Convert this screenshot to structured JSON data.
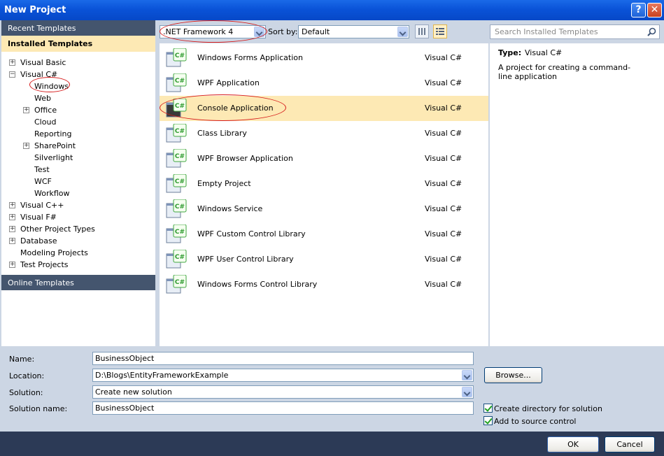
{
  "window": {
    "title": "New Project",
    "help_glyph": "?",
    "close_glyph": "✕"
  },
  "left_panel": {
    "recent_templates": "Recent Templates",
    "installed_templates": "Installed Templates",
    "online_templates": "Online Templates",
    "tree": [
      {
        "label": "Visual Basic",
        "toggle": "+"
      },
      {
        "label": "Visual C#",
        "toggle": "−"
      },
      {
        "label": "Windows",
        "toggle": ""
      },
      {
        "label": "Web",
        "toggle": ""
      },
      {
        "label": "Office",
        "toggle": "+"
      },
      {
        "label": "Cloud",
        "toggle": ""
      },
      {
        "label": "Reporting",
        "toggle": ""
      },
      {
        "label": "SharePoint",
        "toggle": "+"
      },
      {
        "label": "Silverlight",
        "toggle": ""
      },
      {
        "label": "Test",
        "toggle": ""
      },
      {
        "label": "WCF",
        "toggle": ""
      },
      {
        "label": "Workflow",
        "toggle": ""
      },
      {
        "label": "Visual C++",
        "toggle": "+"
      },
      {
        "label": "Visual F#",
        "toggle": "+"
      },
      {
        "label": "Other Project Types",
        "toggle": "+"
      },
      {
        "label": "Database",
        "toggle": "+"
      },
      {
        "label": "Modeling Projects",
        "toggle": ""
      },
      {
        "label": "Test Projects",
        "toggle": "+"
      }
    ]
  },
  "toolbar": {
    "framework": ".NET Framework 4",
    "sort_label": "Sort by:",
    "sort_value": "Default",
    "search_placeholder": "Search Installed Templates"
  },
  "templates": [
    {
      "name": "Windows Forms Application",
      "language": "Visual C#",
      "icon": "windows-forms-app-icon"
    },
    {
      "name": "WPF Application",
      "language": "Visual C#",
      "icon": "wpf-app-icon"
    },
    {
      "name": "Console Application",
      "language": "Visual C#",
      "icon": "console-app-icon"
    },
    {
      "name": "Class Library",
      "language": "Visual C#",
      "icon": "class-library-icon"
    },
    {
      "name": "WPF Browser Application",
      "language": "Visual C#",
      "icon": "wpf-browser-app-icon"
    },
    {
      "name": "Empty Project",
      "language": "Visual C#",
      "icon": "empty-project-icon"
    },
    {
      "name": "Windows Service",
      "language": "Visual C#",
      "icon": "windows-service-icon"
    },
    {
      "name": "WPF Custom Control Library",
      "language": "Visual C#",
      "icon": "wpf-custom-control-icon"
    },
    {
      "name": "WPF User Control Library",
      "language": "Visual C#",
      "icon": "wpf-user-control-icon"
    },
    {
      "name": "Windows Forms Control Library",
      "language": "Visual C#",
      "icon": "winforms-control-library-icon"
    }
  ],
  "icon_badge": "C#",
  "details": {
    "type_label": "Type:",
    "type_value": "Visual C#",
    "description": "A project for creating a command-line application"
  },
  "form": {
    "name_label": "Name:",
    "name_value": "BusinessObject",
    "location_label": "Location:",
    "location_value": "D:\\Blogs\\EntityFrameworkExample",
    "solution_label": "Solution:",
    "solution_value": "Create new solution",
    "solution_name_label": "Solution name:",
    "solution_name_value": "BusinessObject",
    "browse": "Browse...",
    "create_directory": "Create directory for solution",
    "add_source_control": "Add to source control"
  },
  "buttons": {
    "ok": "OK",
    "cancel": "Cancel"
  },
  "colors": {
    "title_bar": "#0a53d8",
    "selection": "#fde9b4",
    "section_header": "#44556e",
    "annotation": "#d61a1a"
  }
}
